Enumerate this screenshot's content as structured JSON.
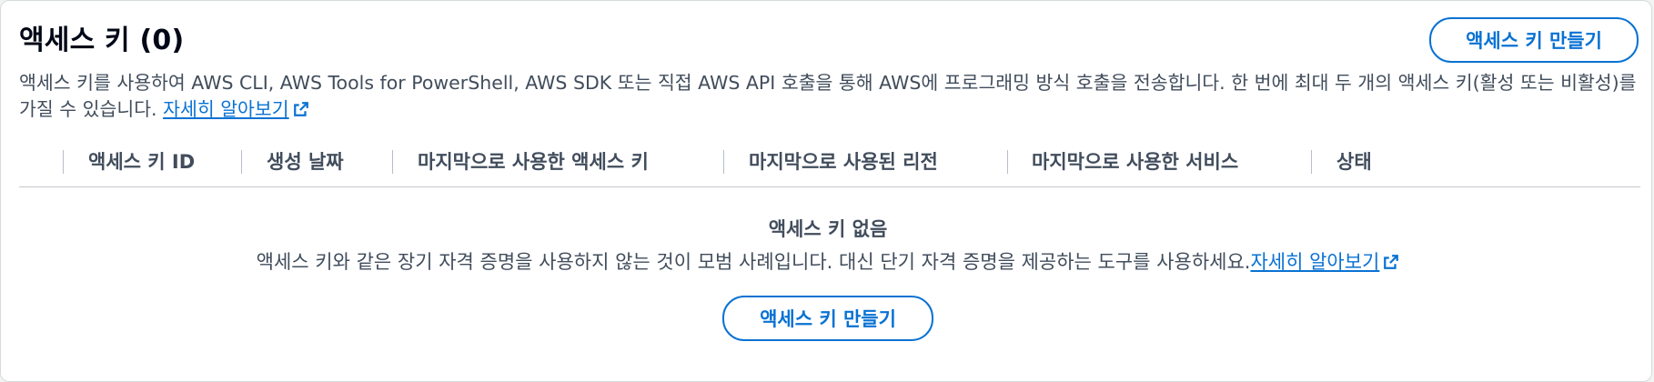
{
  "header": {
    "title": "액세스 키 (0)",
    "create_button": "액세스 키 만들기"
  },
  "description": {
    "text": "액세스 키를 사용하여 AWS CLI, AWS Tools for PowerShell, AWS SDK 또는 직접 AWS API 호출을 통해 AWS에 프로그래밍 방식 호출을 전송합니다. 한 번에 최대 두 개의 액세스 키(활성 또는 비활성)를 가질 수 있습니다. ",
    "link": "자세히 알아보기",
    "link_icon": "external-link-icon"
  },
  "table": {
    "columns": [
      "액세스 키 ID",
      "생성 날짜",
      "마지막으로 사용한 액세스 키",
      "마지막으로 사용된 리전",
      "마지막으로 사용한 서비스",
      "상태"
    ]
  },
  "empty_state": {
    "title": "액세스 키 없음",
    "text": "액세스 키와 같은 장기 자격 증명을 사용하지 않는 것이 모범 사례입니다. 대신 단기 자격 증명을 제공하는 도구를 사용하세요.",
    "link": "자세히 알아보기",
    "link_icon": "external-link-icon",
    "create_button": "액세스 키 만들기"
  },
  "colors": {
    "accent": "#0972d3",
    "text": "#000716",
    "secondary_text": "#414d5c",
    "divider": "#c6c6cd"
  }
}
